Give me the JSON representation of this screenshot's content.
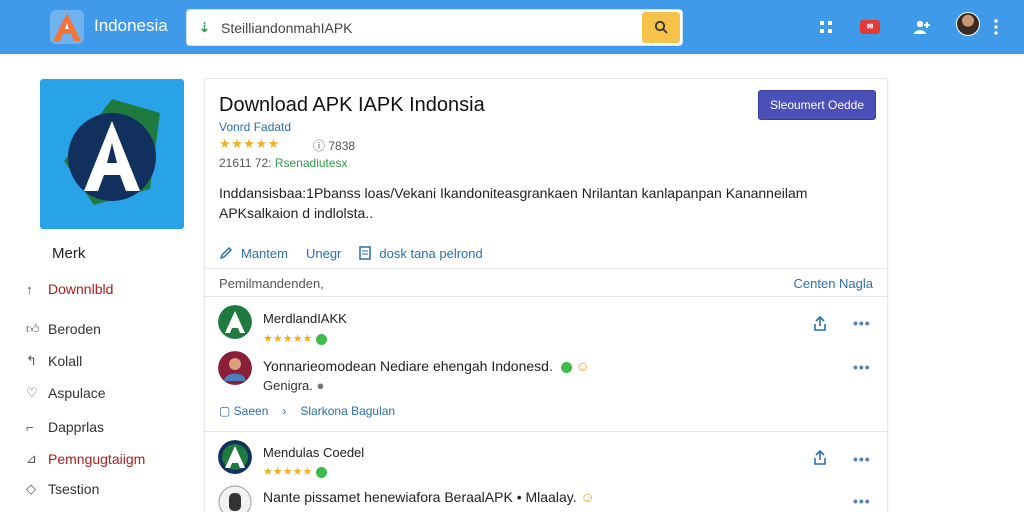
{
  "topbar": {
    "brand": "Indonesia",
    "search_prefix": "⇣",
    "search_value": "SteilliandonmahIAPK",
    "colors": {
      "bar": "#3f9bea",
      "search_button": "#f7c24a",
      "mail_badge": "#e53935"
    },
    "icons": [
      "logo-icon",
      "search-icon",
      "grid-icon",
      "mail-icon",
      "user-add-icon",
      "avatar",
      "kebab-icon"
    ]
  },
  "sidebar": {
    "title": "Merk",
    "items": [
      {
        "label": "Downnlbld",
        "icon": "arrow-up-icon",
        "active": true
      },
      {
        "label": "Beroden",
        "icon": "thumb-up-icon"
      },
      {
        "label": "Kolall",
        "icon": "reply-icon"
      },
      {
        "label": "Aspulace",
        "icon": "heart-plus-icon"
      },
      {
        "label": "Dapprlas",
        "icon": "bookmark-icon"
      },
      {
        "label": "Pemngugtaiigm",
        "icon": "chart-icon"
      },
      {
        "label": "Tsestion",
        "icon": "tag-icon"
      }
    ]
  },
  "app": {
    "title": "Download APK IAPK Indonsia",
    "publisher": "Vonrd Fadatd",
    "stars": "★★★★★",
    "rating_count": "7838",
    "version_prefix": "21611 72:",
    "version_status": "Rsenadiutesx",
    "primary_button": "Sleoumert Oedde",
    "description": "Inddansisbaa:1Pbanss loas/Vekani Ikandoniteasgrankaen Nrilantan kanlapanpan Kananneilam APKsalkaion d indlolsta..",
    "actions": [
      {
        "label": "Mantem",
        "icon": "pencil-icon"
      },
      {
        "label": "Unegr",
        "icon": ""
      },
      {
        "label": "dosk tana pelrond",
        "icon": "document-icon"
      }
    ]
  },
  "reviews_section": {
    "heading": "Pemilmandenden,",
    "link": "Centen Nagla"
  },
  "reviews": [
    {
      "name": "MerdlandIAKK",
      "stars": "★★★★★",
      "comment": "Yonnarieomodean Nediare ehengah Indonesd.",
      "comment_line2": "Genigra.",
      "reply_save": "Saeen",
      "reply_link": "Slarkona Bagulan"
    },
    {
      "name": "Mendulas Coedel",
      "stars": "★★★★★",
      "comment": "Nante pissamet henewiafora BeraalAPK • Mlaalay."
    }
  ]
}
